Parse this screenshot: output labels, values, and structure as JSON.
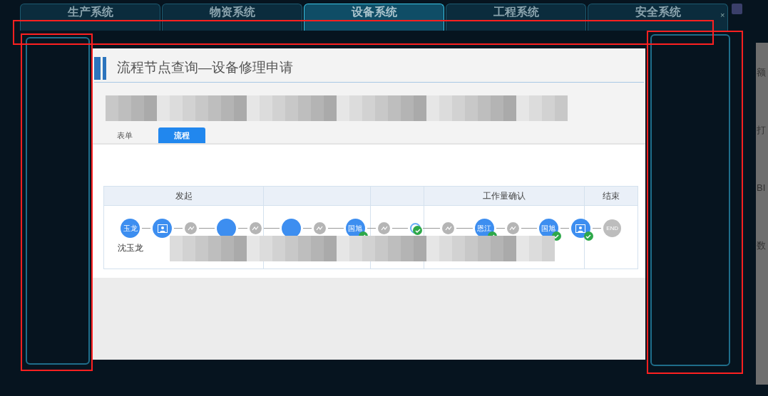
{
  "top_tabs": [
    {
      "label": "生产系统",
      "selected": false
    },
    {
      "label": "物资系统",
      "selected": false
    },
    {
      "label": "设备系统",
      "selected": true
    },
    {
      "label": "工程系统",
      "selected": false
    },
    {
      "label": "安全系统",
      "selected": false
    }
  ],
  "close_glyph": "×",
  "dialog": {
    "title": "流程节点查询—设备修理申请",
    "tabs": [
      {
        "label": "表单",
        "selected": false
      },
      {
        "label": "流程",
        "selected": true
      }
    ],
    "flow": {
      "columns": [
        {
          "title": "发起"
        },
        {},
        {},
        {
          "title": "工作量确认"
        },
        {
          "title": "结束"
        }
      ],
      "nodes": [
        {
          "kind": "person",
          "label": "玉龙",
          "name": "沈玉龙",
          "done": false
        },
        {
          "kind": "form",
          "done": false
        },
        {
          "kind": "gateway"
        },
        {
          "kind": "person",
          "done": false
        },
        {
          "kind": "gateway"
        },
        {
          "kind": "person",
          "done": false
        },
        {
          "kind": "gateway"
        },
        {
          "kind": "person",
          "label": "国旭",
          "done": true
        },
        {
          "kind": "gateway"
        },
        {
          "kind": "hollow",
          "done": true
        },
        {
          "kind": "gateway"
        },
        {
          "kind": "person",
          "label": "恩江",
          "done": true
        },
        {
          "kind": "gateway"
        },
        {
          "kind": "person",
          "label": "国旭",
          "done": true
        },
        {
          "kind": "form",
          "done": true
        },
        {
          "kind": "end",
          "label": "END"
        }
      ]
    }
  },
  "side_texts": [
    "额",
    "打",
    "BI",
    "数"
  ]
}
